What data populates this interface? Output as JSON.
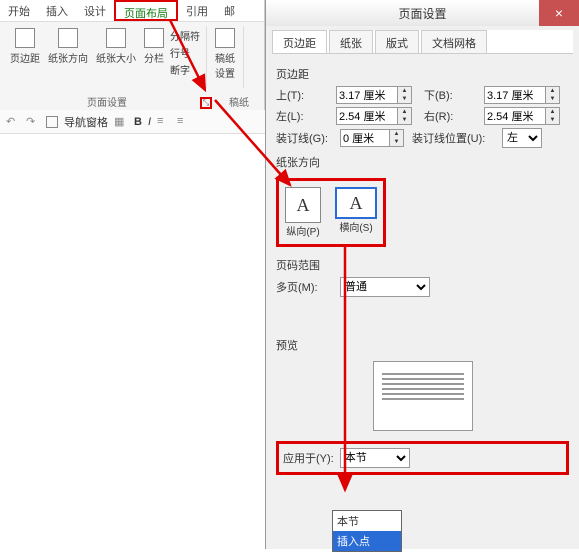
{
  "ribbon": {
    "tabs": [
      "开始",
      "插入",
      "设计",
      "页面布局",
      "引用",
      "邮"
    ],
    "active_tab": "页面布局",
    "buttons": {
      "margins": "页边距",
      "orientation": "纸张方向",
      "size": "纸张大小",
      "columns": "分栏",
      "breaks": "分隔符",
      "line_numbers": "行号",
      "hyphenation": "断字",
      "manuscript": "稿纸\n设置"
    },
    "group1_label": "页面设置",
    "group2_label": "稿纸"
  },
  "toolbar2": {
    "nav_pane": "导航窗格",
    "bold": "B",
    "italic": "I"
  },
  "dialog": {
    "title": "页面设置",
    "close": "×",
    "tabs": [
      "页边距",
      "纸张",
      "版式",
      "文档网格"
    ],
    "active_tab": "页边距",
    "margins_label": "页边距",
    "top_label": "上(T):",
    "top_value": "3.17 厘米",
    "bottom_label": "下(B):",
    "bottom_value": "3.17 厘米",
    "left_label": "左(L):",
    "left_value": "2.54 厘米",
    "right_label": "右(R):",
    "right_value": "2.54 厘米",
    "gutter_label": "装订线(G):",
    "gutter_value": "0 厘米",
    "gutter_pos_label": "装订线位置(U):",
    "gutter_pos_value": "左",
    "orient_label": "纸张方向",
    "portrait": "纵向(P)",
    "landscape": "横向(S)",
    "pages_label": "页码范围",
    "multi_label": "多页(M):",
    "multi_value": "普通",
    "preview_label": "预览",
    "apply_label": "应用于(Y):",
    "apply_value": "本节",
    "apply_options": [
      "本节",
      "插入点"
    ]
  }
}
